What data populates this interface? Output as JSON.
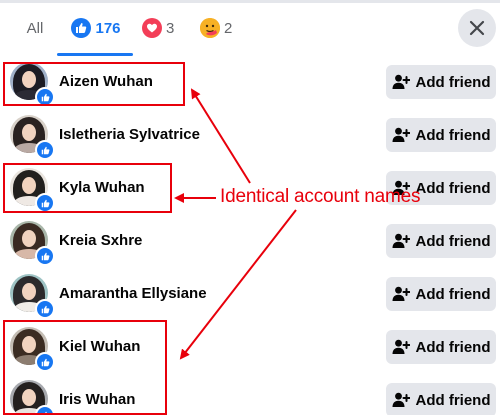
{
  "tabs": {
    "all_label": "All",
    "like_count": "176",
    "love_count": "3",
    "care_count": "2"
  },
  "colors": {
    "like_blue": "#1877f2",
    "love_red": "#f33e58",
    "care_yellow": "#f7b125",
    "button_gray": "#e4e6eb",
    "annotation_red": "#e8000b"
  },
  "people": [
    {
      "name": "Aizen Wuhan",
      "button": "Add friend",
      "avatar": {
        "bg": "#9fb0c8",
        "hair": "#1c1c24",
        "shirt": "#2b2b34"
      }
    },
    {
      "name": "Isletheria Sylvatrice",
      "button": "Add friend",
      "avatar": {
        "bg": "#d8d1c9",
        "hair": "#2a2220",
        "shirt": "#b9a9a3"
      }
    },
    {
      "name": "Kyla Wuhan",
      "button": "Add friend",
      "avatar": {
        "bg": "#e9e4de",
        "hair": "#22201e",
        "shirt": "#efe9e4"
      }
    },
    {
      "name": "Kreia Sxhre",
      "button": "Add friend",
      "avatar": {
        "bg": "#a9b6a9",
        "hair": "#3a2a22",
        "shirt": "#d7b8a8"
      }
    },
    {
      "name": "Amarantha Ellysiane",
      "button": "Add friend",
      "avatar": {
        "bg": "#9ec3c4",
        "hair": "#2c2a2c",
        "shirt": "#f1ede8"
      }
    },
    {
      "name": "Kiel Wuhan",
      "button": "Add friend",
      "avatar": {
        "bg": "#c4bdb4",
        "hair": "#3b2c22",
        "shirt": "#8c7d70"
      }
    },
    {
      "name": "Iris Wuhan",
      "button": "Add friend",
      "avatar": {
        "bg": "#a7a9ae",
        "hair": "#24201f",
        "shirt": "#e7e3df"
      }
    }
  ],
  "annotation": {
    "text": "Identical account names"
  }
}
